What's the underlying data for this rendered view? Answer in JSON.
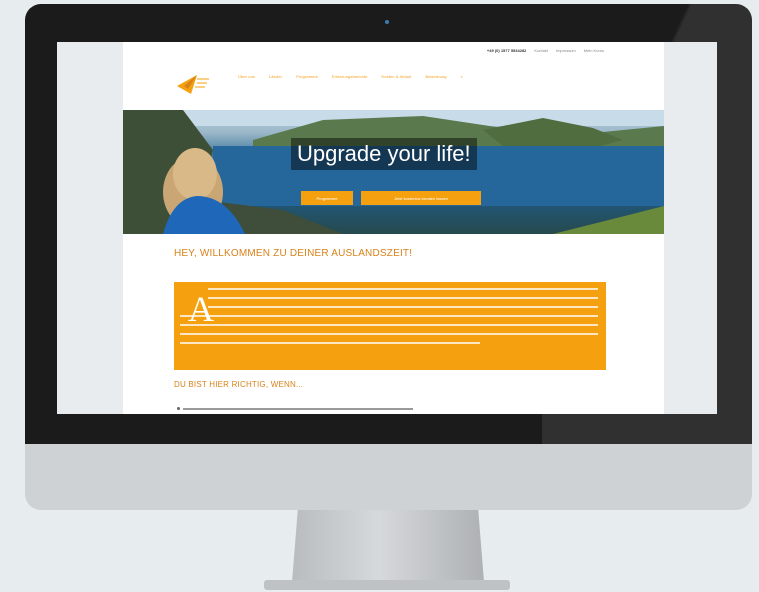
{
  "topbar": {
    "phone": "+49 (0) 1577 5534282",
    "links": [
      "Kontakt",
      "Impressum",
      "Mein Konto"
    ]
  },
  "nav": {
    "items": [
      "Über uns",
      "Länder",
      "Programme",
      "Erfahrungsberichte",
      "Kosten & Ablauf",
      "Bewerbung"
    ],
    "search_icon": "search-icon"
  },
  "hero": {
    "title": "Upgrade your life!",
    "primary_button": "Programme",
    "secondary_button": "Jetzt kostenlos beraten lassen"
  },
  "content": {
    "welcome_heading": "HEY, WILLKOMMEN ZU DEINER AUSLANDSZEIT!",
    "dropcap": "A",
    "section_heading": "DU BIST HIER RICHTIG, WENN..."
  },
  "colors": {
    "accent": "#f5a10f",
    "heading": "#d9821a",
    "bezel": "#1b1b1b"
  }
}
